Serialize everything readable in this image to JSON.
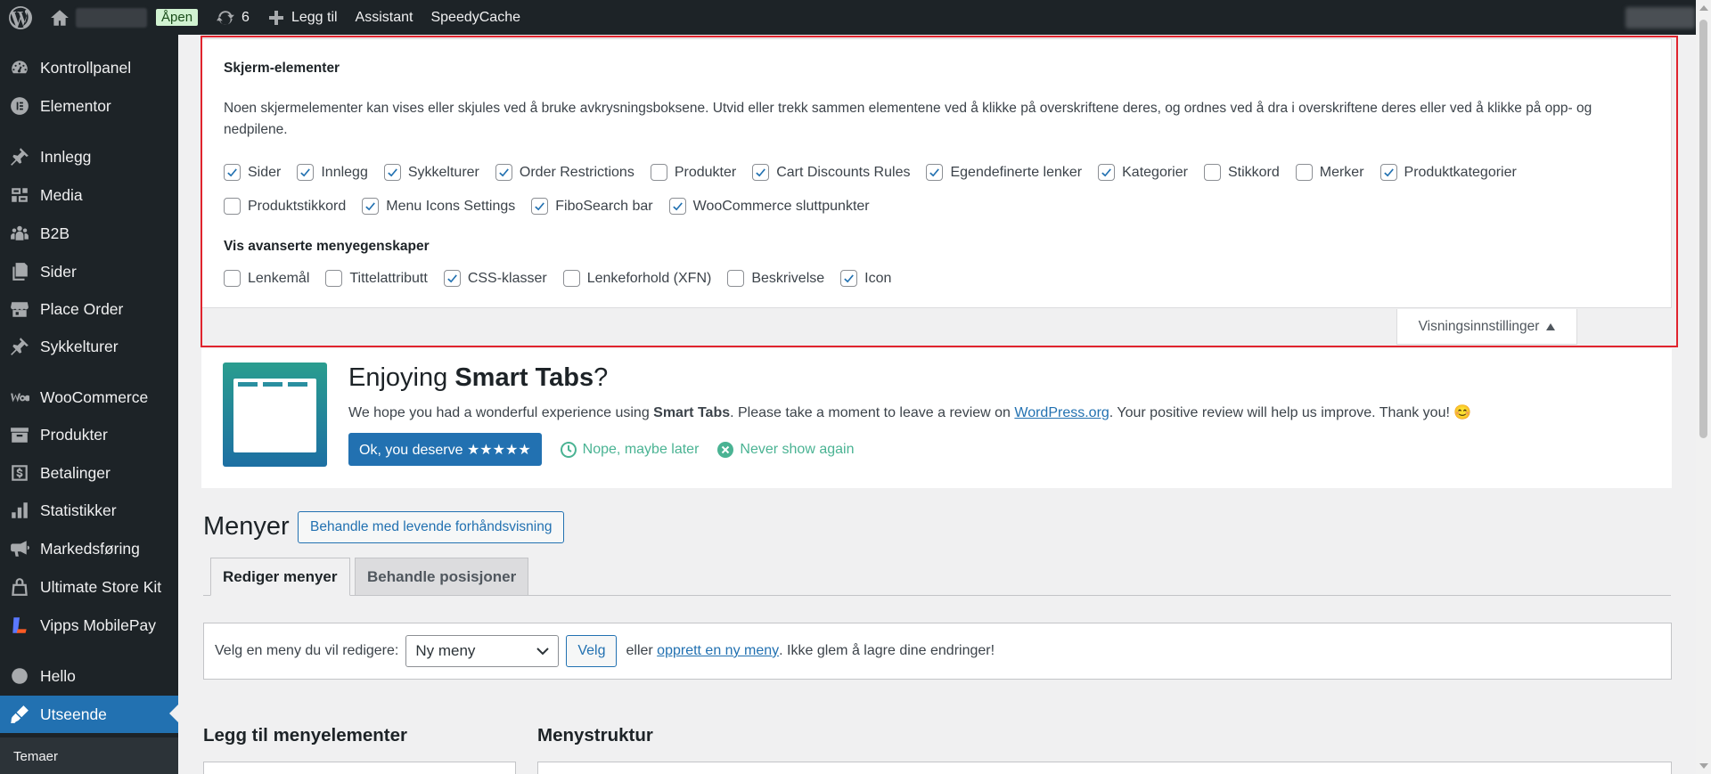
{
  "admin_bar": {
    "badge": "Åpen",
    "updates_count": "6",
    "new_label": "Legg til",
    "assistant": "Assistant",
    "speedycache": "SpeedyCache"
  },
  "sidebar": {
    "items": [
      {
        "label": "Kontrollpanel",
        "icon": "dashboard-icon"
      },
      {
        "label": "Elementor",
        "icon": "elementor-icon"
      },
      {
        "label": "Innlegg",
        "icon": "pin-icon"
      },
      {
        "label": "Media",
        "icon": "media-icon"
      },
      {
        "label": "B2B",
        "icon": "groups-icon"
      },
      {
        "label": "Sider",
        "icon": "pages-icon"
      },
      {
        "label": "Place Order",
        "icon": "store-icon"
      },
      {
        "label": "Sykkelturer",
        "icon": "pin-icon"
      },
      {
        "label": "WooCommerce",
        "icon": "woocommerce-icon"
      },
      {
        "label": "Produkter",
        "icon": "archive-icon"
      },
      {
        "label": "Betalinger",
        "icon": "money-icon"
      },
      {
        "label": "Statistikker",
        "icon": "chart-bar-icon"
      },
      {
        "label": "Markedsføring",
        "icon": "megaphone-icon"
      },
      {
        "label": "Ultimate Store Kit",
        "icon": "lock-bag-icon"
      },
      {
        "label": "Vipps MobilePay",
        "icon": "vipps-icon"
      },
      {
        "label": "Hello",
        "icon": "circle-icon"
      },
      {
        "label": "Utseende",
        "icon": "brush-icon"
      }
    ],
    "submenu_first": "Temaer"
  },
  "screen_options": {
    "heading": "Skjerm-elementer",
    "description": "Noen skjermelementer kan vises eller skjules ved å bruke avkrysningsboksene. Utvid eller trekk sammen elementene ved å klikke på overskriftene deres, og ordnes ved å dra i overskriftene deres eller ved å klikke på opp- og nedpilene.",
    "row1": [
      {
        "label": "Sider",
        "checked": true
      },
      {
        "label": "Innlegg",
        "checked": true
      },
      {
        "label": "Sykkelturer",
        "checked": true
      },
      {
        "label": "Order Restrictions",
        "checked": true
      },
      {
        "label": "Produkter",
        "checked": false
      },
      {
        "label": "Cart Discounts Rules",
        "checked": true
      },
      {
        "label": "Egendefinerte lenker",
        "checked": true
      },
      {
        "label": "Kategorier",
        "checked": true
      },
      {
        "label": "Stikkord",
        "checked": false
      },
      {
        "label": "Merker",
        "checked": false
      },
      {
        "label": "Produktkategorier",
        "checked": true
      }
    ],
    "row2": [
      {
        "label": "Produktstikkord",
        "checked": false
      },
      {
        "label": "Menu Icons Settings",
        "checked": true
      },
      {
        "label": "FiboSearch bar",
        "checked": true
      },
      {
        "label": "WooCommerce sluttpunkter",
        "checked": true
      }
    ],
    "advanced_heading": "Vis avanserte menyegenskaper",
    "row3": [
      {
        "label": "Lenkemål",
        "checked": false
      },
      {
        "label": "Tittelattributt",
        "checked": false
      },
      {
        "label": "CSS-klasser",
        "checked": true
      },
      {
        "label": "Lenkeforhold (XFN)",
        "checked": false
      },
      {
        "label": "Beskrivelse",
        "checked": false
      },
      {
        "label": "Icon",
        "checked": true
      }
    ],
    "toggle_label": "Visningsinnstillinger"
  },
  "notice": {
    "title_pre": "Enjoying ",
    "title_bold": "Smart Tabs",
    "title_post": "?",
    "text_pre": "We hope you had a wonderful experience using ",
    "text_bold": "Smart Tabs",
    "text_mid": ". Please take a moment to leave a review on ",
    "text_link": "WordPress.org",
    "text_post": ". Your positive review will help us improve. Thank you! 😊",
    "btn_review": "Ok, you deserve ★★★★★",
    "btn_later": "Nope, maybe later",
    "btn_never": "Never show again"
  },
  "menus": {
    "title": "Menyer",
    "live_preview": "Behandle med levende forhåndsvisning",
    "tab_edit": "Rediger menyer",
    "tab_locations": "Behandle posisjoner",
    "select_label": "Velg en meny du vil redigere:",
    "select_value": "Ny meny",
    "select_btn": "Velg",
    "or_text": "eller",
    "create_link": "opprett en ny meny",
    "save_reminder": ". Ikke glem å lagre dine endringer!",
    "add_items_heading": "Legg til menyelementer",
    "structure_heading": "Menystruktur"
  }
}
